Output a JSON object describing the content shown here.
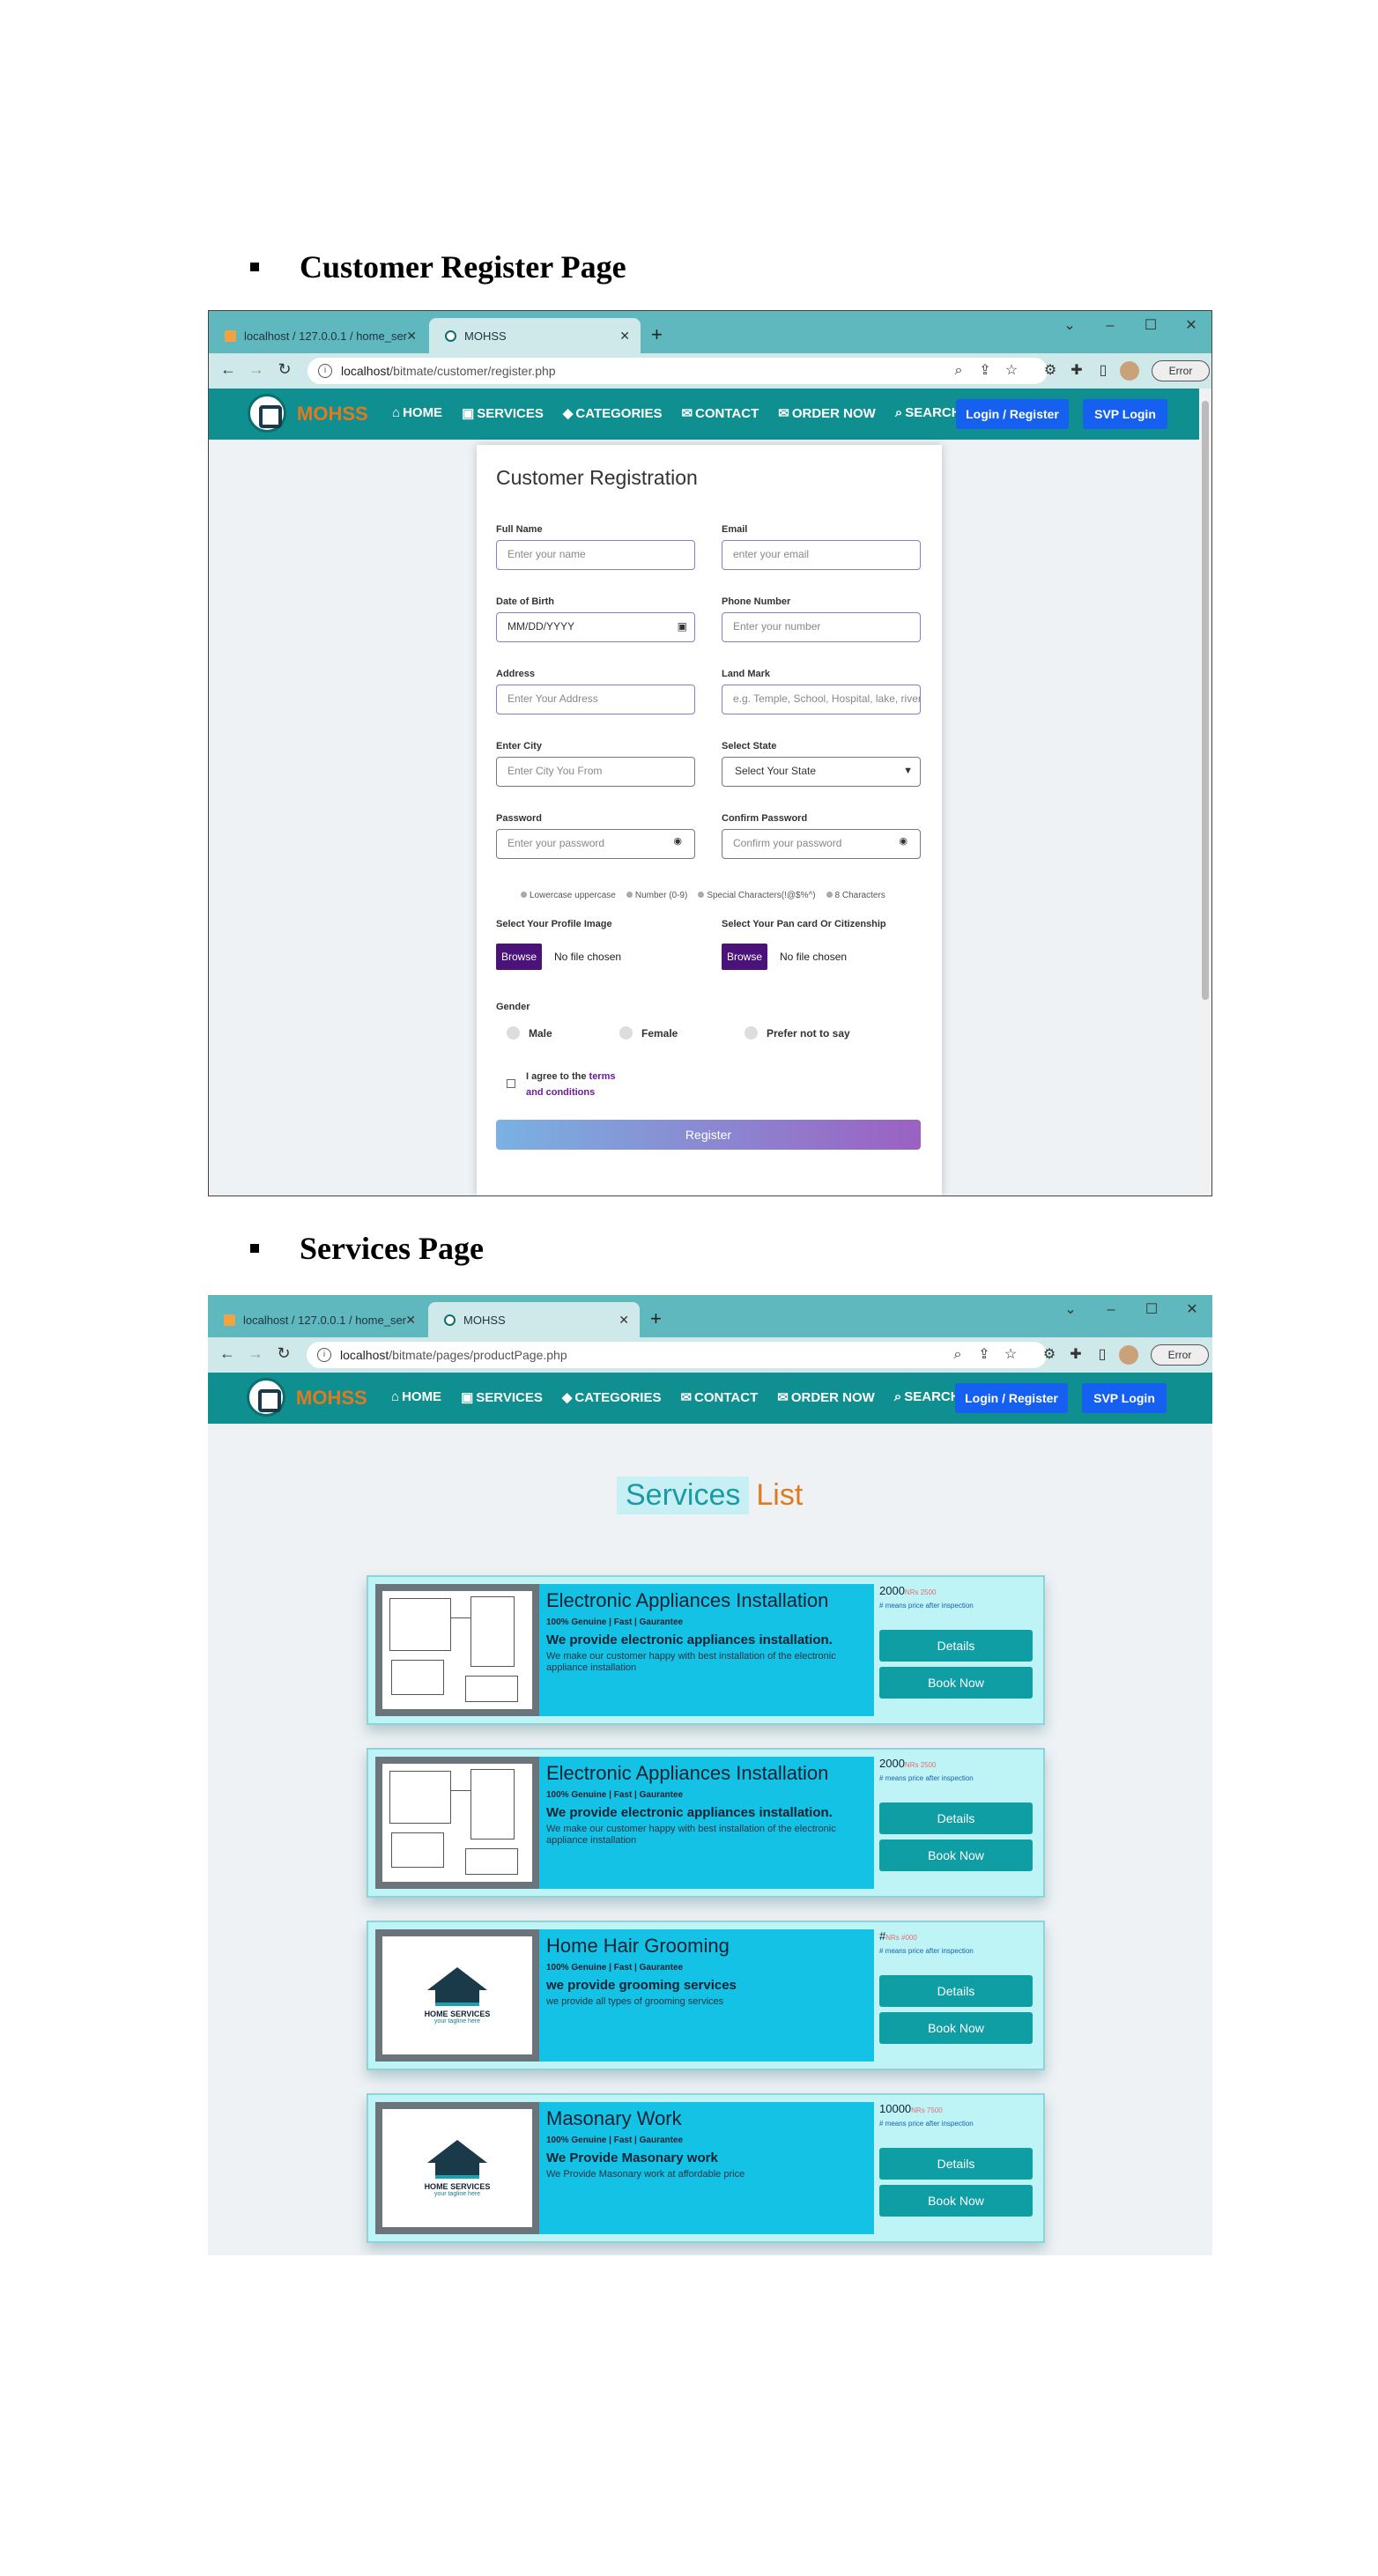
{
  "section1": {
    "heading": "Customer Register Page"
  },
  "section2": {
    "heading": "Services Page"
  },
  "browser1": {
    "tab_inactive": "localhost / 127.0.0.1 / home_ser",
    "tab_active": "MOHSS",
    "url_host": "localhost",
    "url_path": "/bitmate/customer/register.php",
    "error_label": "Error"
  },
  "browser2": {
    "tab_inactive": "localhost / 127.0.0.1 / home_ser",
    "tab_active": "MOHSS",
    "url_host": "localhost",
    "url_path": "/bitmate/pages/productPage.php",
    "error_label": "Error"
  },
  "nav": {
    "brand": "MOHSS",
    "items": [
      "HOME",
      "SERVICES",
      "CATEGORIES",
      "CONTACT",
      "ORDER NOW",
      "SEARCH"
    ],
    "login": "Login / Register",
    "svp": "SVP Login"
  },
  "register": {
    "title": "Customer Registration",
    "full_name_label": "Full Name",
    "full_name_ph": "Enter your name",
    "email_label": "Email",
    "email_ph": "enter your email",
    "dob_label": "Date of Birth",
    "dob_ph": "MM/DD/YYYY",
    "phone_label": "Phone Number",
    "phone_ph": "Enter your number",
    "address_label": "Address",
    "address_ph": "Enter Your Address",
    "landmark_label": "Land Mark",
    "landmark_ph": "e.g. Temple, School, Hospital, lake, river",
    "city_label": "Enter City",
    "city_ph": "Enter City You From",
    "state_label": "Select State",
    "state_value": "Select Your State",
    "password_label": "Password",
    "password_ph": "Enter your password",
    "confirm_label": "Confirm Password",
    "confirm_ph": "Confirm your password",
    "requirements": [
      "Lowercase uppercase",
      "Number (0-9)",
      "Special Characters(!@$%^)",
      "8 Characters"
    ],
    "profile_label": "Select Your Profile Image",
    "pan_label": "Select Your Pan card Or Citizenship",
    "browse": "Browse",
    "no_file": "No file chosen",
    "gender_label": "Gender",
    "genders": [
      "Male",
      "Female",
      "Prefer not to say"
    ],
    "agree_prefix": "I agree to the",
    "agree_link1": "terms",
    "agree_link2": "and conditions",
    "submit": "Register"
  },
  "services": {
    "title_a": "Services",
    "title_b": "List",
    "cards": [
      {
        "title": "Electronic Appliances Installation",
        "tag": "100% Genuine | Fast | Gaurantee",
        "headline": "We provide electronic appliances installation.",
        "desc": "We make our customer happy with best installation of the electronic appliance installation",
        "price": "2000",
        "price_old": "NRs 2500",
        "note": "# means price after inspection",
        "details": "Details",
        "book": "Book Now",
        "thumb": "diagram"
      },
      {
        "title": "Electronic Appliances Installation",
        "tag": "100% Genuine | Fast | Gaurantee",
        "headline": "We provide electronic appliances installation.",
        "desc": "We make our customer happy with best installation of the electronic appliance installation",
        "price": "2000",
        "price_old": "NRs 2500",
        "note": "# means price after inspection",
        "details": "Details",
        "book": "Book Now",
        "thumb": "diagram"
      },
      {
        "title": "Home Hair Grooming",
        "tag": "100% Genuine | Fast | Gaurantee",
        "headline": "we provide grooming services",
        "desc": "we provide all types of grooming services",
        "price": "#",
        "price_old": "NRs #000",
        "note": "# means price after inspection",
        "details": "Details",
        "book": "Book Now",
        "thumb": "logo"
      },
      {
        "title": "Masonary Work",
        "tag": "100% Genuine | Fast | Gaurantee",
        "headline": "We Provide Masonary work",
        "desc": "We Provide Masonary work at affordable price",
        "price": "10000",
        "price_old": "NRs 7500",
        "note": "# means price after inspection",
        "details": "Details",
        "book": "Book Now",
        "thumb": "logo"
      }
    ],
    "logo_text": "HOME SERVICES",
    "logo_tagline": "your tagline here"
  },
  "colors": {
    "teal": "#0f8f8f",
    "brand_orange": "#e07a1f",
    "login_blue": "#1560f0",
    "card_cyan": "#14c2e6"
  }
}
